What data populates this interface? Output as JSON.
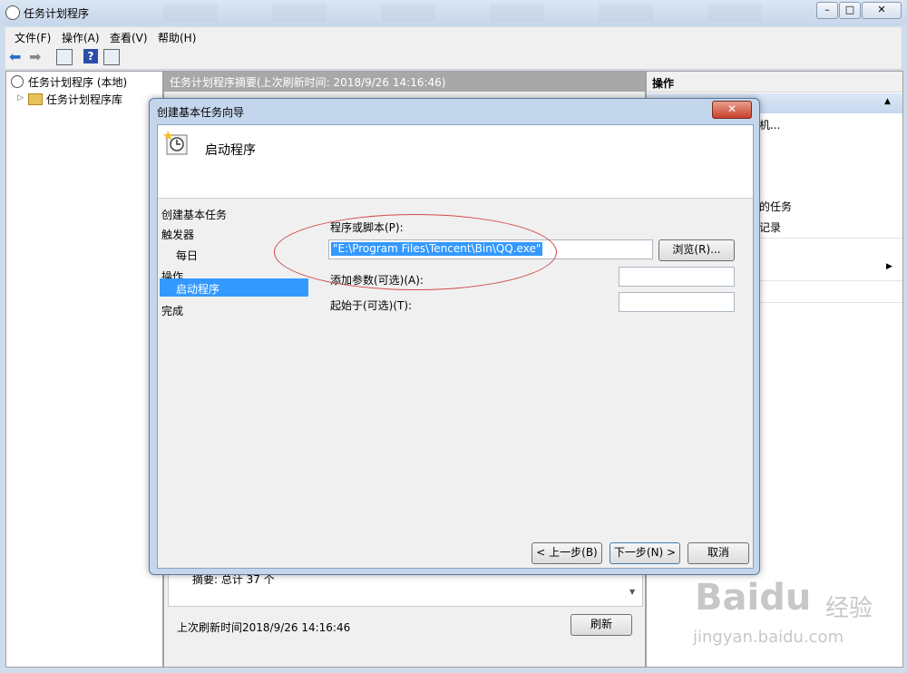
{
  "window": {
    "title": "任务计划程序",
    "min": "–",
    "max": "□",
    "close": "✕"
  },
  "menubar": [
    "文件(F)",
    "操作(A)",
    "查看(V)",
    "帮助(H)"
  ],
  "tree": {
    "root": "任务计划程序 (本地)",
    "child": "任务计划程序库"
  },
  "center": {
    "header": "任务计划程序摘要(上次刷新时间: 2018/9/26 14:16:46)",
    "summary": "摘要: 总计 37 个",
    "last_refresh": "上次刷新时间2018/9/26 14:16:46",
    "refresh_button": "刷新"
  },
  "right": {
    "header": "操作",
    "items": [
      "机...",
      "的任务",
      "记录"
    ]
  },
  "dialog": {
    "title": "创建基本任务向导",
    "close": "✕",
    "heading": "启动程序",
    "steps": [
      "创建基本任务",
      "触发器",
      "每日",
      "操作",
      "启动程序",
      "完成"
    ],
    "program_label": "程序或脚本(P):",
    "program_value": "\"E:\\Program Files\\Tencent\\Bin\\QQ.exe\"",
    "browse_button": "浏览(R)...",
    "args_label": "添加参数(可选)(A):",
    "start_label": "起始于(可选)(T):",
    "back_button": "< 上一步(B)",
    "next_button": "下一步(N) >",
    "cancel_button": "取消"
  },
  "watermark": {
    "brand": "Baidu",
    "cn": "经验",
    "url": "jingyan.baidu.com"
  }
}
